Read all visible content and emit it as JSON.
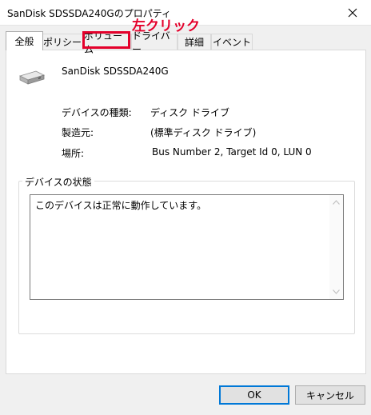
{
  "window": {
    "title": "SanDisk SDSSDA240Gのプロパティ"
  },
  "tabs": [
    {
      "label": "全般",
      "selected": true
    },
    {
      "label": "ポリシー",
      "selected": false
    },
    {
      "label": "ボリューム",
      "selected": false
    },
    {
      "label": "ドライバー",
      "selected": false
    },
    {
      "label": "詳細",
      "selected": false
    },
    {
      "label": "イベント",
      "selected": false
    }
  ],
  "annotation": {
    "label": "左クリック",
    "color": "#e4002b"
  },
  "device": {
    "icon": "drive-icon",
    "name": "SanDisk SDSSDA240G",
    "properties": [
      {
        "label": "デバイスの種類:",
        "value": "ディスク ドライブ"
      },
      {
        "label": "製造元:",
        "value": "(標準ディスク ドライブ)"
      },
      {
        "label": "場所:",
        "value": "Bus Number 2, Target Id 0, LUN 0"
      }
    ]
  },
  "status": {
    "group_label": "デバイスの状態",
    "text": "このデバイスは正常に動作しています。"
  },
  "buttons": {
    "ok": "OK",
    "cancel": "キャンセル"
  }
}
